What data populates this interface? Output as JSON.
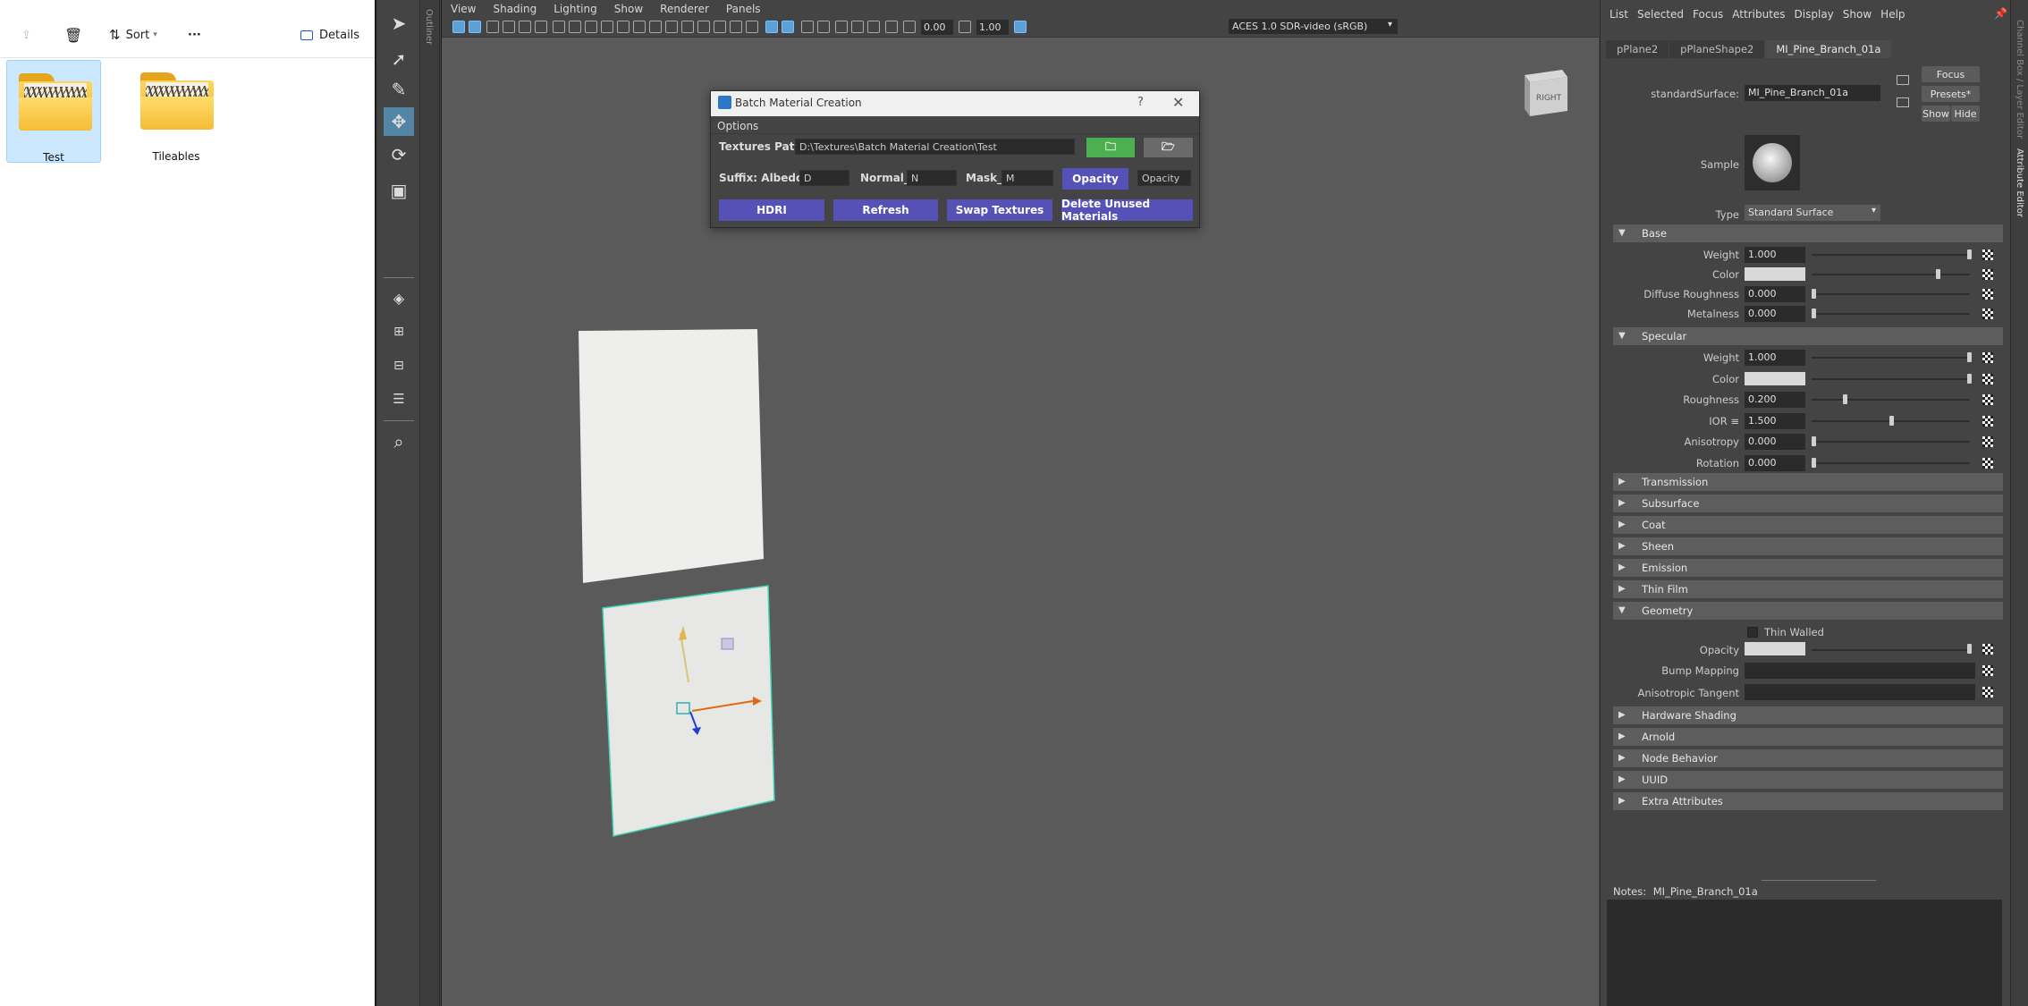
{
  "explorer": {
    "sort_label": "Sort",
    "more_label": "···",
    "details_label": "Details",
    "folders": [
      {
        "name": "Test",
        "selected": true
      },
      {
        "name": "Tileables",
        "selected": false
      }
    ]
  },
  "outliner_tab": "Outliner",
  "viewport": {
    "menus": [
      "View",
      "Shading",
      "Lighting",
      "Show",
      "Renderer",
      "Panels"
    ],
    "exposure": "0.00",
    "gamma": "1.00",
    "color_space": "ACES 1.0 SDR-video (sRGB)",
    "viewcube_label": "RIGHT"
  },
  "dialog": {
    "title": "Batch Material Creation",
    "help": "?",
    "close": "✕",
    "menu": "Options",
    "textures_path_label": "Textures Path:",
    "textures_path_value": "D:\\Textures\\Batch Material Creation\\Test",
    "suffix_label": "Suffix: Albedo_",
    "albedo_value": "D",
    "normal_label": "Normal_",
    "normal_value": "N",
    "mask_label": "Mask_",
    "mask_value": "M",
    "opacity_button": "Opacity",
    "opacity_value": "Opacity",
    "hdri_button": "HDRI",
    "refresh_button": "Refresh",
    "swap_button": "Swap Textures",
    "delete_button": "Delete Unused Materials",
    "colors": {
      "accent": "#5551b6",
      "green": "#4caf50"
    }
  },
  "attr_editor": {
    "menus": [
      "List",
      "Selected",
      "Focus",
      "Attributes",
      "Display",
      "Show",
      "Help"
    ],
    "tabs": [
      {
        "label": "pPlane2",
        "active": false
      },
      {
        "label": "pPlaneShape2",
        "active": false
      },
      {
        "label": "MI_Pine_Branch_01a",
        "active": true
      }
    ],
    "node_label": "standardSurface:",
    "node_value": "MI_Pine_Branch_01a",
    "focus_btn": "Focus",
    "presets_btn": "Presets*",
    "show_btn": "Show",
    "hide_btn": "Hide",
    "sample_label": "Sample",
    "type_label": "Type",
    "type_value": "Standard Surface",
    "base": {
      "title": "Base",
      "rows": [
        {
          "label": "Weight",
          "value": "1.000",
          "slider": 1.0,
          "kind": "num"
        },
        {
          "label": "Color",
          "value": "",
          "slider": 0.8,
          "kind": "color"
        },
        {
          "label": "Diffuse Roughness",
          "value": "0.000",
          "slider": 0.0,
          "kind": "num"
        },
        {
          "label": "Metalness",
          "value": "0.000",
          "slider": 0.0,
          "kind": "num"
        }
      ]
    },
    "specular": {
      "title": "Specular",
      "rows": [
        {
          "label": "Weight",
          "value": "1.000",
          "slider": 1.0,
          "kind": "num"
        },
        {
          "label": "Color",
          "value": "",
          "slider": 1.0,
          "kind": "color"
        },
        {
          "label": "Roughness",
          "value": "0.200",
          "slider": 0.2,
          "kind": "num"
        },
        {
          "label": "IOR ≡",
          "value": "1.500",
          "slider": 0.5,
          "kind": "num"
        },
        {
          "label": "Anisotropy",
          "value": "0.000",
          "slider": 0.0,
          "kind": "num"
        },
        {
          "label": "Rotation",
          "value": "0.000",
          "slider": 0.0,
          "kind": "num"
        }
      ]
    },
    "collapsed_1": [
      "Transmission",
      "Subsurface",
      "Coat",
      "Sheen",
      "Emission",
      "Thin Film"
    ],
    "geometry": {
      "title": "Geometry",
      "thin_walled": "Thin Walled",
      "opacity": "Opacity",
      "bump": "Bump Mapping",
      "aniso": "Anisotropic Tangent"
    },
    "collapsed_2": [
      "Hardware Shading",
      "Arnold",
      "Node Behavior",
      "UUID",
      "Extra Attributes"
    ],
    "notes_label": "Notes:",
    "notes_value": "MI_Pine_Branch_01a"
  },
  "right_strip": {
    "tab1": "Channel Box / Layer Editor",
    "tab2": "Attribute Editor"
  }
}
